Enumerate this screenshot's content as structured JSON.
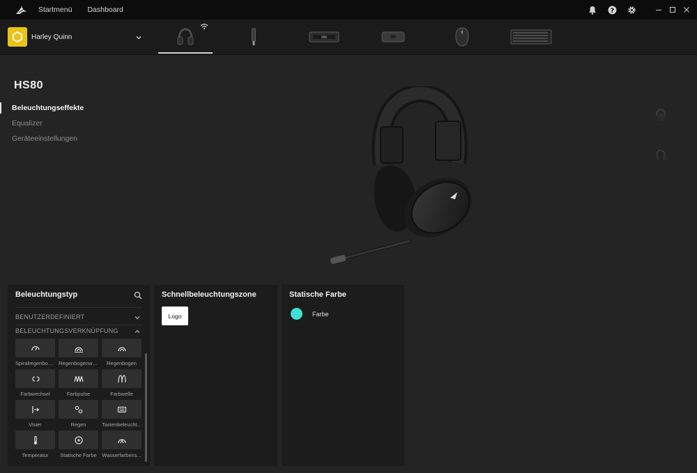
{
  "titlebar": {
    "nav": [
      {
        "label": "Startmenü"
      },
      {
        "label": "Dashboard"
      }
    ],
    "icons": [
      "bell-icon",
      "help-icon",
      "gear-icon"
    ]
  },
  "profile": {
    "name": "Harley Quinn",
    "badge_color": "#e8c31a"
  },
  "devices": [
    {
      "name": "headset",
      "active": true
    },
    {
      "name": "usb-dongle"
    },
    {
      "name": "memory-module"
    },
    {
      "name": "hub"
    },
    {
      "name": "mouse"
    },
    {
      "name": "keyboard"
    }
  ],
  "device": {
    "name": "HS80",
    "nav": [
      {
        "label": "Beleuchtungseffekte",
        "active": true
      },
      {
        "label": "Equalizer"
      },
      {
        "label": "Geräteeinstellungen"
      }
    ]
  },
  "lighting": {
    "title": "Beleuchtungstyp",
    "sections": [
      {
        "label": "BENUTZERDEFINIERT",
        "expanded": false
      },
      {
        "label": "BELEUCHTUNGSVERKNÜPFUNG",
        "expanded": true
      }
    ],
    "effects": [
      {
        "label": "Spiralregenbog...",
        "icon": "spiral-rainbow-icon"
      },
      {
        "label": "Regenbogenwe...",
        "icon": "rainbow-wave-icon"
      },
      {
        "label": "Regenbogen",
        "icon": "rainbow-icon"
      },
      {
        "label": "Farbwechsel",
        "icon": "color-shift-icon"
      },
      {
        "label": "Farbpulse",
        "icon": "color-pulse-icon"
      },
      {
        "label": "Farbwelle",
        "icon": "color-wave-icon"
      },
      {
        "label": "Visier",
        "icon": "visor-icon"
      },
      {
        "label": "Regen",
        "icon": "rain-icon"
      },
      {
        "label": "Tastenbeleucht...",
        "icon": "keyboard-icon"
      },
      {
        "label": "Temperatur",
        "icon": "thermometer-icon"
      },
      {
        "label": "Statische Farbe",
        "icon": "static-color-icon"
      },
      {
        "label": "Wasserfarbens...",
        "icon": "watercolor-icon"
      }
    ]
  },
  "quickzone": {
    "title": "Schnellbeleuchtungszone",
    "zone": "Logo"
  },
  "static": {
    "title": "Statische Farbe",
    "color_label": "Farbe",
    "color": "#40e0d0"
  }
}
